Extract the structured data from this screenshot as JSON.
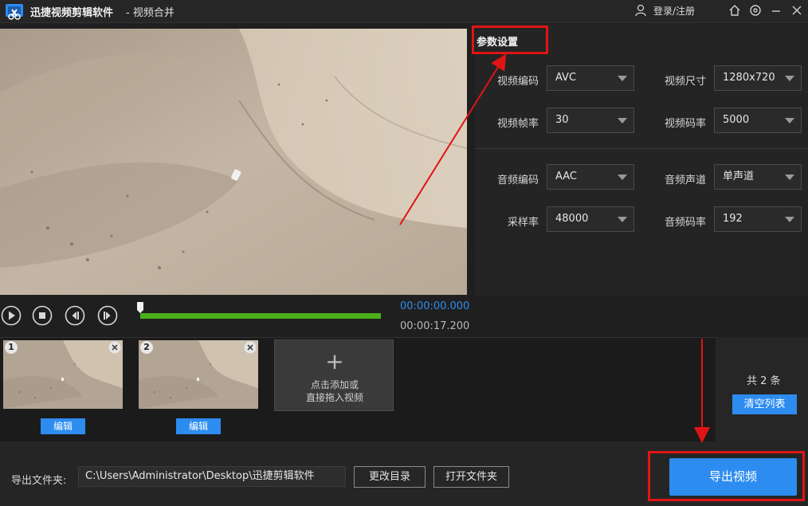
{
  "titlebar": {
    "app_name": "迅捷视频剪辑软件",
    "subtitle": "- 视频合并",
    "login": "登录/注册",
    "icons": [
      "app-logo",
      "user-icon",
      "home-icon",
      "settings-icon",
      "minimize-icon",
      "close-icon"
    ]
  },
  "settings": {
    "title": "参数设置",
    "video_codec": {
      "label": "视频编码",
      "value": "AVC"
    },
    "video_size": {
      "label": "视频尺寸",
      "value": "1280x720"
    },
    "frame_rate": {
      "label": "视频帧率",
      "value": "30"
    },
    "video_bitrate": {
      "label": "视频码率",
      "value": "5000"
    },
    "audio_codec": {
      "label": "音频编码",
      "value": "AAC"
    },
    "audio_channel": {
      "label": "音频声道",
      "value": "单声道"
    },
    "sample_rate": {
      "label": "采样率",
      "value": "48000"
    },
    "audio_bitrate": {
      "label": "音频码率",
      "value": "192"
    }
  },
  "player": {
    "current_time": "00:00:00.000",
    "total_time": "00:00:17.200",
    "progress": 0.0,
    "icons": [
      "play-icon",
      "stop-icon",
      "previous-icon",
      "next-icon"
    ]
  },
  "clips": {
    "items": [
      {
        "number": "1",
        "edit_label": "编辑"
      },
      {
        "number": "2",
        "edit_label": "编辑"
      }
    ],
    "add_line1": "点击添加或",
    "add_line2": "直接拖入视频",
    "count": "共 2 条",
    "clear_label": "清空列表"
  },
  "footer": {
    "output_label": "导出文件夹:",
    "output_path": "C:\\Users\\Administrator\\Desktop\\迅捷剪辑软件",
    "change_dir": "更改目录",
    "open_folder": "打开文件夹",
    "export_label": "导出视频"
  },
  "colors": {
    "accent": "#2d8cf0",
    "progress": "#4caf1a",
    "annotation": "#e01414",
    "background": "#1f1f1f"
  }
}
